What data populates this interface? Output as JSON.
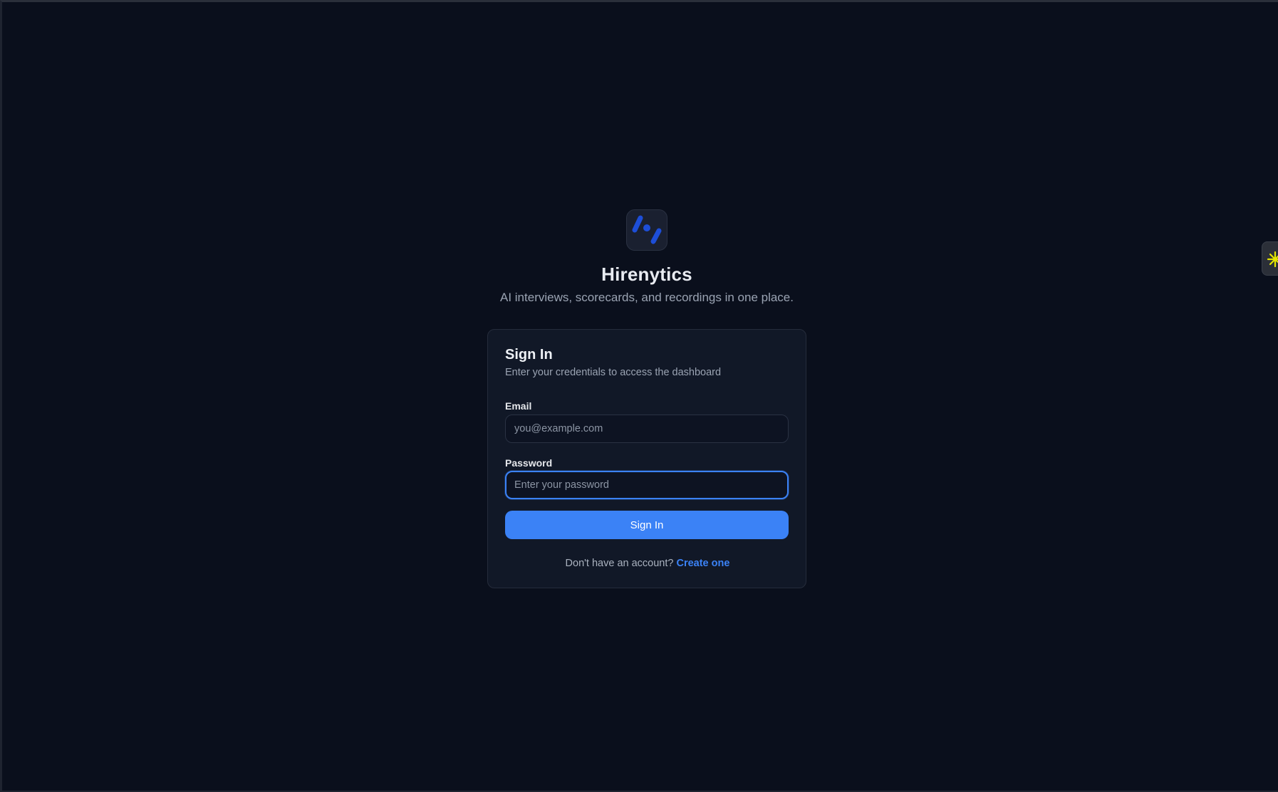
{
  "brand": {
    "name": "Hirenytics",
    "tagline": "AI interviews, scorecards, and recordings in one place.",
    "logo_icon": "hirenytics-logo-icon",
    "accent_color": "#3b82f6"
  },
  "card": {
    "title": "Sign In",
    "subtitle": "Enter your credentials to access the dashboard"
  },
  "form": {
    "email_label": "Email",
    "email_placeholder": "you@example.com",
    "email_value": "",
    "password_label": "Password",
    "password_placeholder": "Enter your password",
    "password_value": "",
    "submit_label": "Sign In"
  },
  "footer": {
    "prompt": "Don't have an account?",
    "link_label": "Create one"
  },
  "extension": {
    "icon": "sparkle-icon",
    "color": "#e5e500"
  }
}
